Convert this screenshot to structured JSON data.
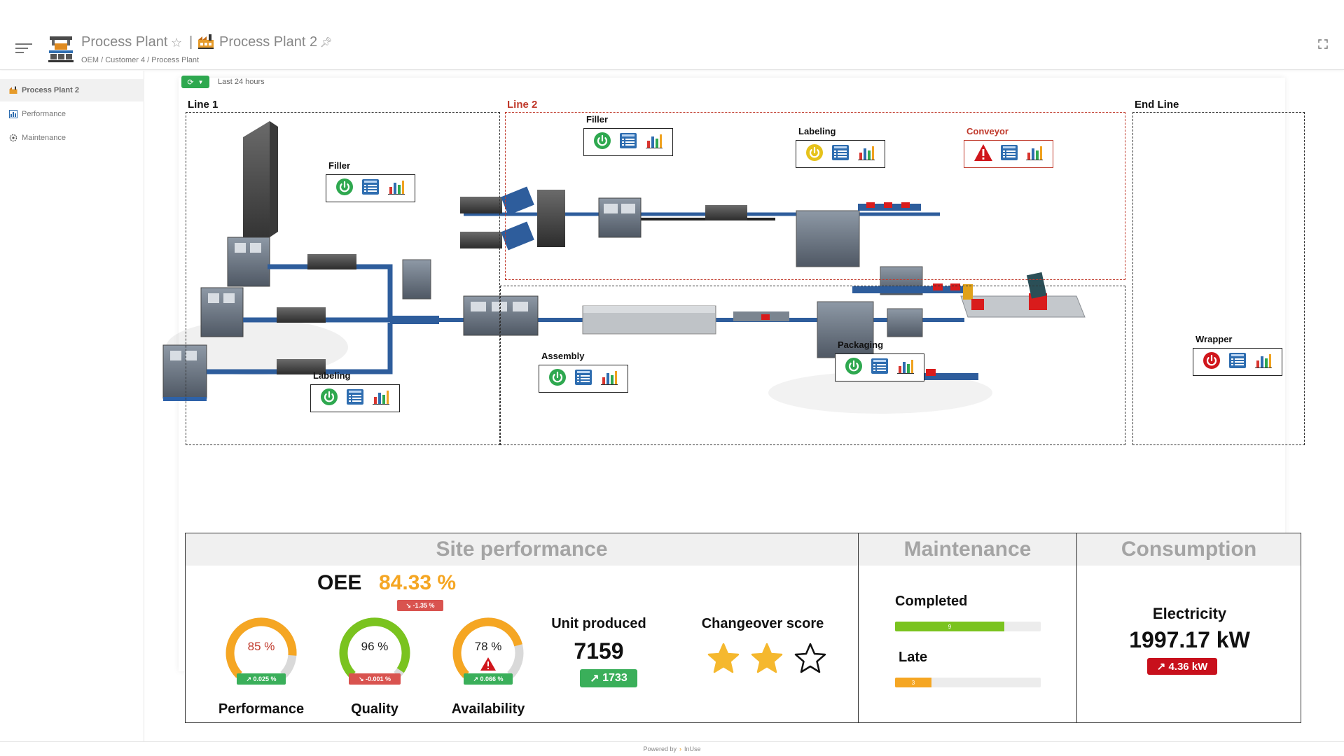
{
  "header": {
    "title": "Process Plant",
    "separator": "|",
    "subtitle": "Process Plant 2",
    "breadcrumb": "OEM / Customer 4 / Process Plant"
  },
  "sidebar": {
    "items": [
      {
        "label": "Process Plant 2",
        "icon": "factory-icon"
      },
      {
        "label": "Performance",
        "icon": "bar-chart-icon"
      },
      {
        "label": "Maintenance",
        "icon": "gear-icon"
      }
    ]
  },
  "toolbar": {
    "refresh_icon": "refresh-icon",
    "time_range": "Last 24 hours"
  },
  "lines": {
    "line1": "Line 1",
    "line2": "Line 2",
    "end_line": "End Line"
  },
  "machines": {
    "filler1": {
      "label": "Filler",
      "status": "running",
      "status_color": "#2ea84f"
    },
    "labeling1": {
      "label": "Labeling",
      "status": "running",
      "status_color": "#2ea84f"
    },
    "filler2": {
      "label": "Filler",
      "status": "running",
      "status_color": "#2ea84f"
    },
    "labeling2": {
      "label": "Labeling",
      "status": "idle",
      "status_color": "#e6c21a"
    },
    "conveyor": {
      "label": "Conveyor",
      "status": "alarm",
      "status_color": "#d0161c"
    },
    "assembly": {
      "label": "Assembly",
      "status": "running",
      "status_color": "#2ea84f"
    },
    "packaging": {
      "label": "Packaging",
      "status": "running",
      "status_color": "#2ea84f"
    },
    "wrapper": {
      "label": "Wrapper",
      "status": "stopped",
      "status_color": "#d0161c"
    }
  },
  "site_performance": {
    "title": "Site performance",
    "oee_label": "OEE",
    "oee_value": "84.33 %",
    "oee_change": "-1.35 %",
    "gauges": [
      {
        "label": "Performance",
        "value": "85 %",
        "level": 85,
        "change": "0.025 %",
        "trend": "up",
        "arc_color": "#f5a623",
        "value_color": "#c0392b"
      },
      {
        "label": "Quality",
        "value": "96 %",
        "level": 96,
        "change": "-0.001 %",
        "trend": "down",
        "arc_color": "#7ac31f",
        "value_color": "#222"
      },
      {
        "label": "Availability",
        "value": "78 %",
        "level": 78,
        "change": "0.066 %",
        "trend": "up",
        "arc_color": "#f5a623",
        "value_color": "#222",
        "warning": true
      }
    ],
    "units_label": "Unit produced",
    "units_value": "7159",
    "units_change": "1733",
    "changeover_label": "Changeover score",
    "changeover_score": 2,
    "changeover_max": 3
  },
  "maintenance": {
    "title": "Maintenance",
    "completed_label": "Completed",
    "completed_value": "9",
    "completed_fraction": 0.75,
    "late_label": "Late",
    "late_value": "3",
    "late_fraction": 0.25
  },
  "consumption": {
    "title": "Consumption",
    "electricity_label": "Electricity",
    "electricity_value": "1997.17 kW",
    "electricity_change": "4.36 kW"
  },
  "footer": {
    "powered_by": "Powered by",
    "brand": "InUse"
  },
  "colors": {
    "accent_green": "#2ea84f",
    "alarm_red": "#c0392b",
    "oee_orange": "#f5a623"
  }
}
